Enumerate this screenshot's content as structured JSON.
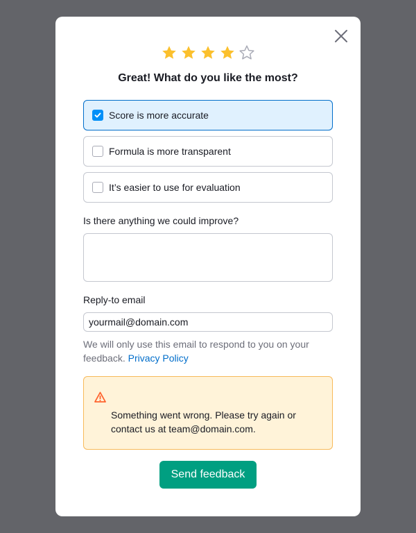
{
  "modal": {
    "title": "Great! What do you like the most?",
    "rating": {
      "value": 4,
      "max": 5,
      "filled_color": "#fbc02d",
      "empty_color": "#a9abb6"
    },
    "options": [
      {
        "label": "Score is more accurate",
        "checked": true
      },
      {
        "label": "Formula is more transparent",
        "checked": false
      },
      {
        "label": "It’s easier to use for evaluation",
        "checked": false
      }
    ],
    "improve_label": "Is there anything we could improve?",
    "improve_value": "",
    "email_label": "Reply-to email",
    "email_value": "yourmail@domain.com",
    "hint_text": "We will only use this email to respond to you on your feedback.",
    "privacy_link": "Privacy Policy",
    "alert": {
      "icon": "warning-icon",
      "message": "Something went wrong. Please try again or contact us at team@domain.com."
    },
    "send_label": "Send feedback",
    "colors": {
      "accent": "#009f81",
      "selected_bg": "#e0f1fe",
      "selected_border": "#006dca",
      "alert_bg": "#fff3d9",
      "alert_border": "#f7b95a",
      "warning": "#ff622d"
    }
  }
}
